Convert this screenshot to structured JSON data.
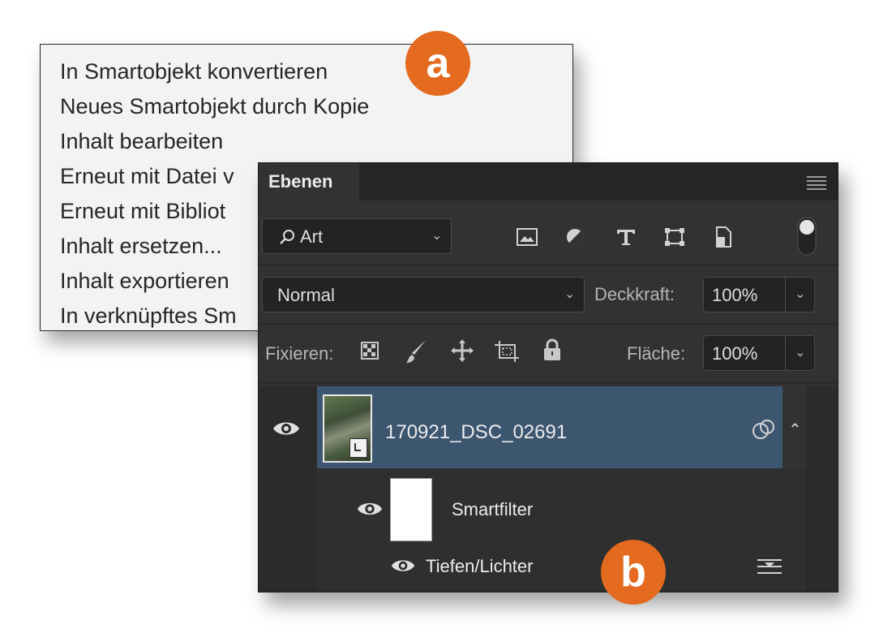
{
  "context_menu": {
    "items": [
      "In Smartobjekt konvertieren",
      "Neues Smartobjekt durch Kopie",
      "Inhalt bearbeiten",
      "Erneut mit Datei v",
      "Erneut mit Bibliot",
      "Inhalt ersetzen...",
      "Inhalt exportieren",
      "In verknüpftes Sm"
    ]
  },
  "badges": {
    "a": "a",
    "b": "b"
  },
  "panel": {
    "tab_label": "Ebenen",
    "filter": {
      "label": "Art",
      "icons": [
        "image-filter-icon",
        "adjustment-filter-icon",
        "type-filter-icon",
        "shape-filter-icon",
        "smartobject-filter-icon",
        "filter-toggle-icon"
      ]
    },
    "blend_mode": "Normal",
    "opacity": {
      "label": "Deckkraft:",
      "value": "100%"
    },
    "lock": {
      "label": "Fixieren:",
      "icons": [
        "lock-transparent-icon",
        "lock-paint-icon",
        "lock-position-icon",
        "lock-artboard-icon",
        "lock-all-icon"
      ]
    },
    "fill": {
      "label": "Fläche:",
      "value": "100%"
    },
    "layers": [
      {
        "name": "170921_DSC_02691",
        "type": "smart-object",
        "selected": true
      },
      {
        "name": "Smartfilter",
        "type": "smart-filter-mask"
      },
      {
        "name": "Tiefen/Lichter",
        "type": "filter"
      }
    ]
  },
  "colors": {
    "accent": "#e36a1f",
    "selection": "#3d5670",
    "panel_bg": "#323232"
  }
}
